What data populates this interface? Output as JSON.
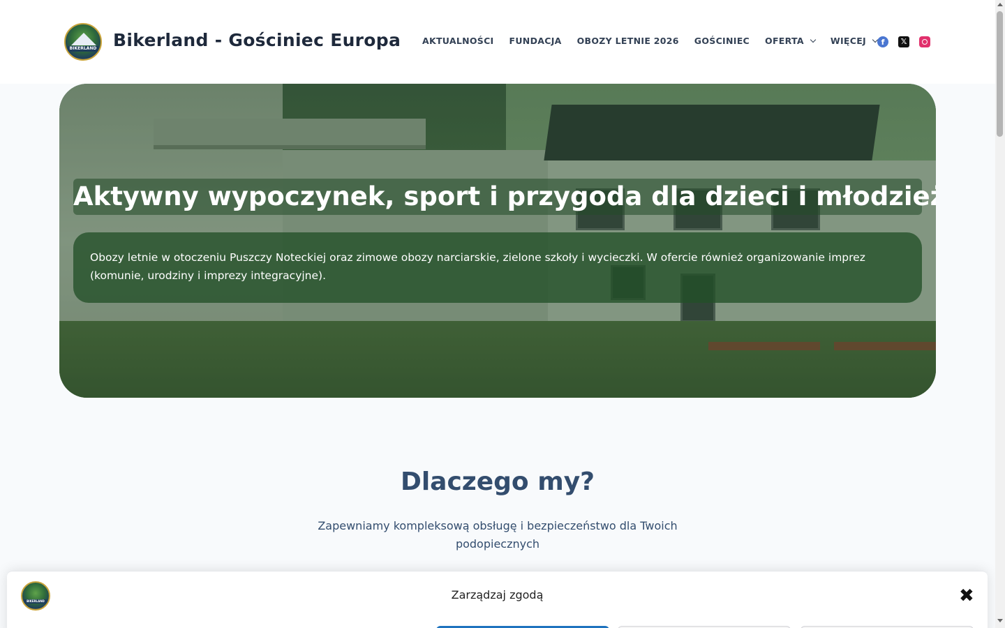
{
  "header": {
    "site_title": "Bikerland - Gościniec Europa",
    "logo_text": "BIKERLAND",
    "nav": [
      {
        "label": "AKTUALNOŚCI",
        "has_dropdown": false
      },
      {
        "label": "FUNDACJA",
        "has_dropdown": false
      },
      {
        "label": "OBOZY LETNIE 2026",
        "has_dropdown": false
      },
      {
        "label": "GOŚCINIEC",
        "has_dropdown": false
      },
      {
        "label": "OFERTA",
        "has_dropdown": true
      },
      {
        "label": "WIĘCEJ",
        "has_dropdown": true
      }
    ],
    "social": [
      "facebook-icon",
      "x-icon",
      "instagram-icon"
    ]
  },
  "hero": {
    "title": "Aktywny wypoczynek, sport i przygoda dla dzieci i młodzieży",
    "text": "Obozy letnie w otoczeniu Puszczy Noteckiej oraz zimowe obozy narciarskie, zielone szkoły i wycieczki. W ofercie również organizowanie imprez (komunie, urodziny i imprezy integracyjne)."
  },
  "why": {
    "title": "Dlaczego my?",
    "subtitle": "Zapewniamy kompleksową obsługę i bezpieczeństwo dla Twoich podopiecznych"
  },
  "cookie": {
    "title": "Zarządzaj zgodą",
    "close": "✖"
  },
  "colors": {
    "accent": "#1e73be",
    "heading": "#334d6e",
    "hero_overlay": "#23502a"
  }
}
